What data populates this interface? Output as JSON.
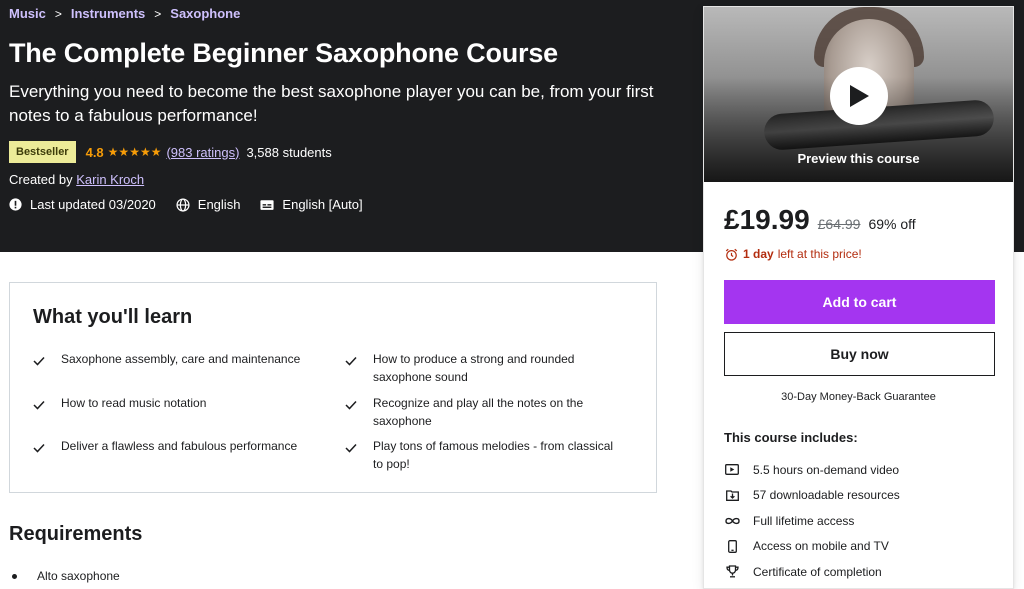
{
  "breadcrumb": {
    "items": [
      "Music",
      "Instruments",
      "Saxophone"
    ],
    "separator": ">"
  },
  "course": {
    "title": "The Complete Beginner Saxophone Course",
    "subtitle": "Everything you need to become the best saxophone player you can be, from your first notes to a fabulous performance!",
    "badge": "Bestseller",
    "rating": "4.8",
    "stars": "★★★★★",
    "ratings_count": "(983 ratings)",
    "students": "3,588 students",
    "created_by_label": "Created by",
    "author": "Karin Kroch",
    "last_updated": "Last updated 03/2020",
    "language": "English",
    "captions": "English [Auto]"
  },
  "sidebar": {
    "preview_label": "Preview this course",
    "price": "£19.99",
    "original_price": "£64.99",
    "discount": "69% off",
    "timer_bold": "1 day",
    "timer_rest": "left at this price!",
    "add_to_cart": "Add to cart",
    "buy_now": "Buy now",
    "guarantee": "30-Day Money-Back Guarantee",
    "includes_title": "This course includes:",
    "includes": [
      {
        "icon": "video-icon",
        "label": "5.5 hours on-demand video"
      },
      {
        "icon": "download-icon",
        "label": "57 downloadable resources"
      },
      {
        "icon": "infinity-icon",
        "label": "Full lifetime access"
      },
      {
        "icon": "mobile-icon",
        "label": "Access on mobile and TV"
      },
      {
        "icon": "trophy-icon",
        "label": "Certificate of completion"
      }
    ]
  },
  "learn": {
    "title": "What you'll learn",
    "items": [
      "Saxophone assembly, care and maintenance",
      "How to produce a strong and rounded saxophone sound",
      "How to read music notation",
      "Recognize and play all the notes on the saxophone",
      "Deliver a flawless and fabulous performance",
      "Play tons of famous melodies - from classical to pop!"
    ]
  },
  "requirements": {
    "title": "Requirements",
    "items": [
      "Alto saxophone"
    ]
  },
  "colors": {
    "hero_bg": "#1c1d1f",
    "accent": "#a435f0",
    "link_purple": "#cec0fc",
    "star_orange": "#f69c08",
    "badge_bg": "#eceb98",
    "timer_red": "#b32d0f"
  }
}
